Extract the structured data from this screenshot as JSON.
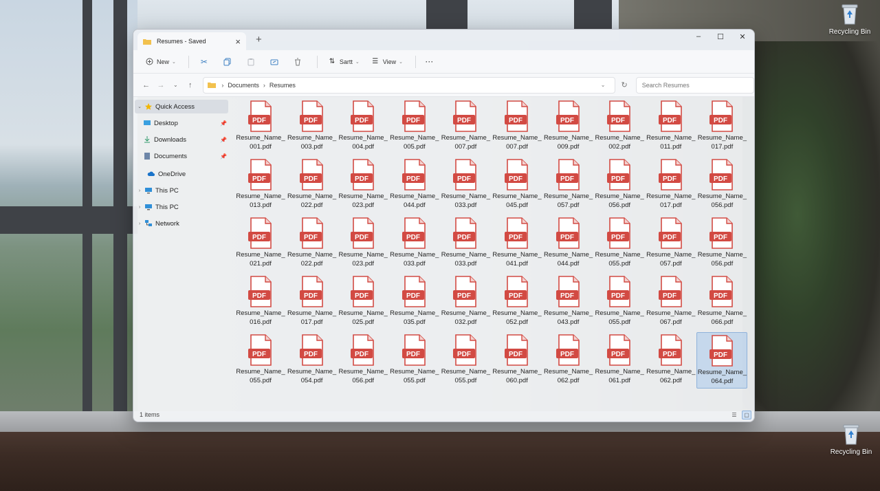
{
  "desktop": {
    "icons": [
      {
        "label": "Recycling Bin"
      },
      {
        "label": "Recycling Bin"
      }
    ]
  },
  "window": {
    "tab_title": "Resumes - Saved",
    "tab_close": "×",
    "new_tab": "+",
    "controls": {
      "minimize": "–",
      "maximize": "☐",
      "close": "✕"
    }
  },
  "toolbar": {
    "new_label": "New",
    "sort_label": "Sartt",
    "view_label": "View",
    "more_label": "···"
  },
  "address": {
    "crumbs": [
      "Documents",
      "Resumes"
    ],
    "search_placeholder": "Search Resumes"
  },
  "nav": {
    "items": [
      {
        "label": "Quick Access"
      },
      {
        "label": "Desktop"
      },
      {
        "label": "Downloads"
      },
      {
        "label": "Documents"
      },
      {
        "label": "OneDrive"
      },
      {
        "label": "This PC"
      },
      {
        "label": "This PC"
      },
      {
        "label": "Network"
      }
    ]
  },
  "files": {
    "icon_label": "PDF",
    "prefix": "Resume_Name_",
    "names": [
      "001.pdf",
      "003.pdf",
      "004.pdf",
      "005.pdf",
      "007.pdf",
      "007.pdf",
      "009.pdf",
      "002.pdf",
      "011.pdf",
      "017.pdf",
      "013.pdf",
      "022.pdf",
      "023.pdf",
      "044.pdf",
      "033.pdf",
      "045.pdf",
      "057.pdf",
      "056.pdf",
      "017.pdf",
      "056.pdf",
      "021.pdf",
      "022.pdf",
      "023.pdf",
      "033.pdf",
      "033.pdf",
      "041.pdf",
      "044.pdf",
      "055.pdf",
      "057.pdf",
      "056.pdf",
      "016.pdf",
      "017.pdf",
      "025.pdf",
      "035.pdf",
      "032.pdf",
      "052.pdf",
      "043.pdf",
      "055.pdf",
      "067.pdf",
      "066.pdf",
      "055.pdf",
      "054.pdf",
      "056.pdf",
      "055.pdf",
      "055.pdf",
      "060.pdf",
      "062.pdf",
      "061.pdf",
      "062.pdf",
      "064.pdf"
    ],
    "selected_index": 49
  },
  "status": {
    "count_text": "1 items"
  },
  "colors": {
    "pdf_red": "#d24a43",
    "accent": "#0067c0"
  }
}
